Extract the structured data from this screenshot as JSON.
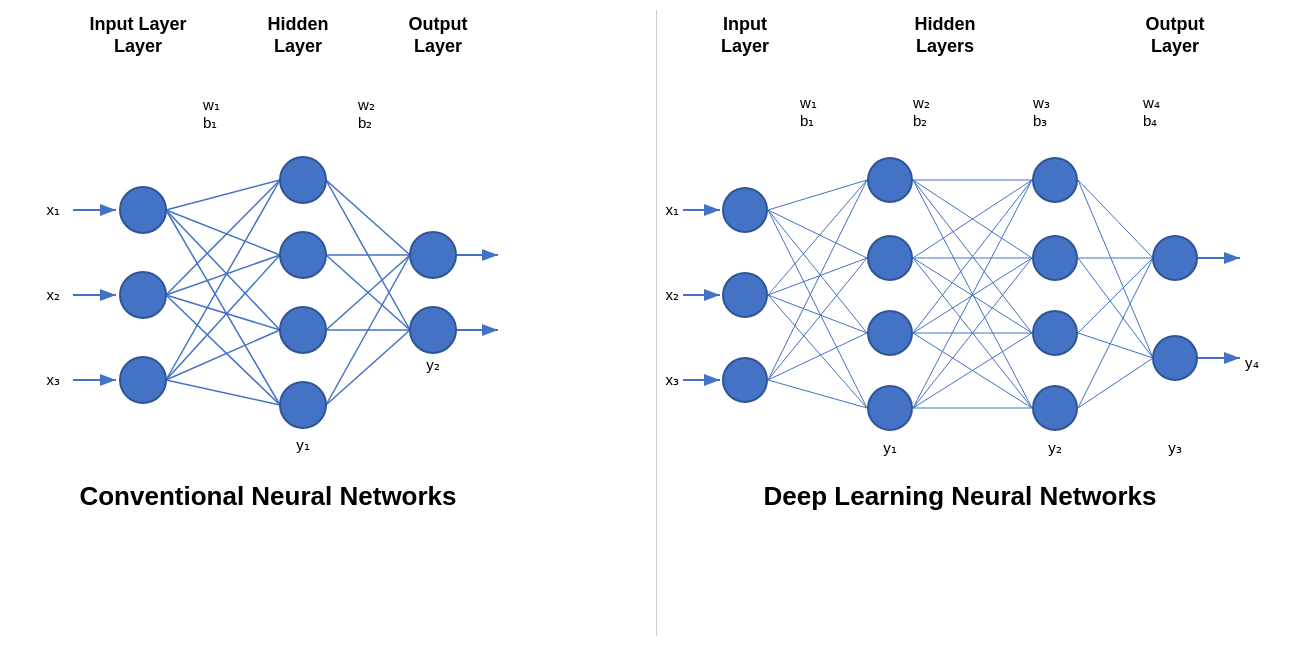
{
  "left_diagram": {
    "title": "Conventional Neural Networks",
    "headers": {
      "input": "Input Layer",
      "hidden": "Hidden Layer",
      "output": "Output Layer"
    },
    "labels": {
      "w1": "w₁",
      "b1": "b₁",
      "w2": "w₂",
      "b2": "b₂",
      "x1": "x₁",
      "x2": "x₂",
      "x3": "x₃",
      "y1": "y₁",
      "y2": "y₂"
    }
  },
  "right_diagram": {
    "title": "Deep Learning Neural Networks",
    "headers": {
      "input": "Input Layer",
      "hidden": "Hidden Layers",
      "output": "Output Layer"
    },
    "labels": {
      "w1": "w₁",
      "b1": "b₁",
      "w2": "w₂",
      "b2": "b₂",
      "w3": "w₃",
      "b3": "b₃",
      "w4": "w₄",
      "b4": "b₄",
      "x1": "x₁",
      "x2": "x₂",
      "x3": "x₃",
      "y1": "y₁",
      "y2": "y₂",
      "y3": "y₃",
      "y4": "y₄"
    }
  }
}
